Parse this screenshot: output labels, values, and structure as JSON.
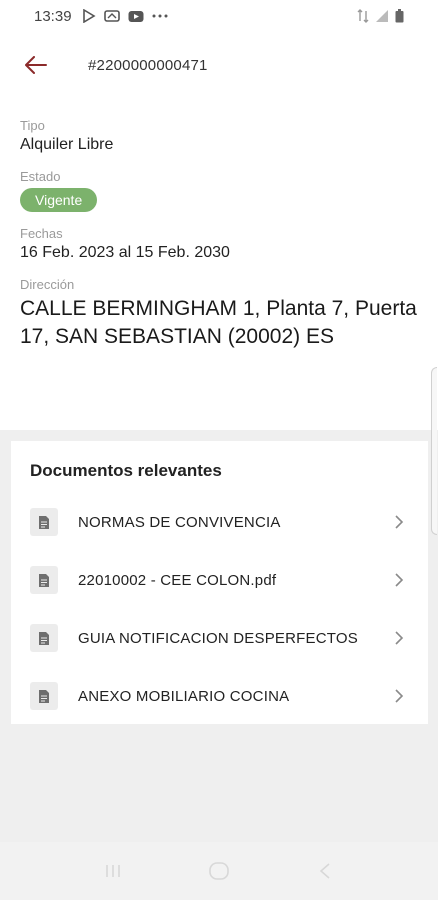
{
  "status_bar": {
    "time": "13:39",
    "notification_icons": [
      "play-store-icon",
      "cast-icon",
      "youtube-icon",
      "more-dots-icon"
    ],
    "system_icons": [
      "data-arrows-icon",
      "signal-icon",
      "battery-icon"
    ]
  },
  "app_bar": {
    "title": "#2200000000471",
    "back_icon": "arrow-left-icon",
    "accent_color": "#8b2a2a"
  },
  "details": {
    "tipo_label": "Tipo",
    "tipo_value": "Alquiler Libre",
    "estado_label": "Estado",
    "estado_value": "Vigente",
    "estado_color": "#7cb26c",
    "fechas_label": "Fechas",
    "fechas_value": "16 Feb. 2023 al 15 Feb. 2030",
    "direccion_label": "Dirección",
    "direccion_value": "CALLE BERMINGHAM 1, Planta 7, Puerta 17, SAN SEBASTIAN (20002) ES"
  },
  "documents": {
    "title": "Documentos relevantes",
    "items": [
      {
        "label": "NORMAS DE CONVIVENCIA",
        "icon": "document-icon"
      },
      {
        "label": "22010002 - CEE COLON.pdf",
        "icon": "document-icon"
      },
      {
        "label": "GUIA NOTIFICACION DESPERFECTOS",
        "icon": "document-icon"
      },
      {
        "label": "ANEXO MOBILIARIO COCINA",
        "icon": "document-icon"
      }
    ]
  },
  "nav_bar": {
    "buttons": [
      "recent-apps-icon",
      "home-icon",
      "back-icon"
    ]
  }
}
